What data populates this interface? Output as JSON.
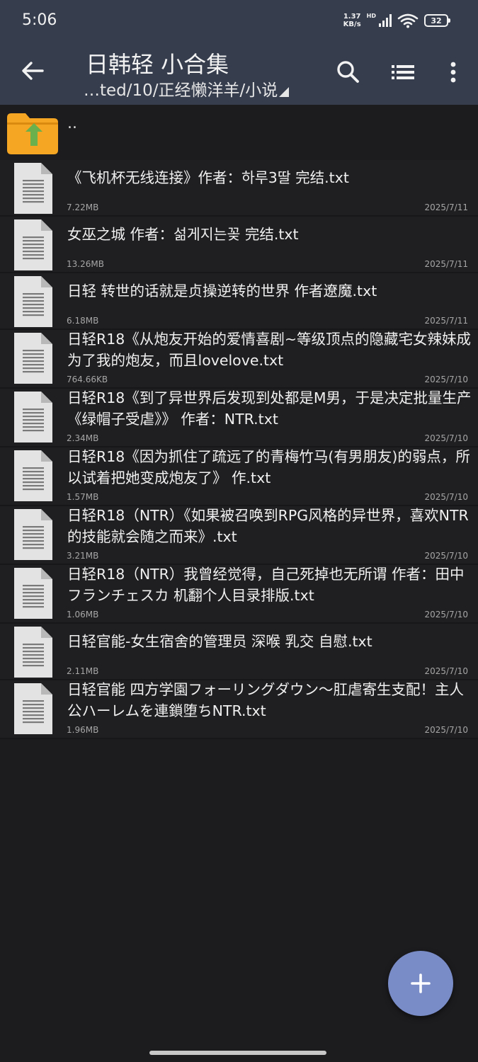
{
  "status_bar": {
    "time": "5:06",
    "net_speed_value": "1.37",
    "net_speed_unit": "KB/s",
    "signal_label": "HD",
    "battery_level": "32"
  },
  "toolbar": {
    "title": "日韩轻 小合集",
    "path": "…ted/10/正经懒洋羊/小说",
    "icons": [
      "back-arrow-icon",
      "search-icon",
      "list-view-icon",
      "more-vert-icon"
    ]
  },
  "parent_entry": {
    "label": ".."
  },
  "files": [
    {
      "name": "《飞机杯无线连接》作者：하루3딸 完结.txt",
      "size": "7.22MB",
      "date": "2025/7/11"
    },
    {
      "name": "女巫之城 作者：섦게지는꽂 完结.txt",
      "size": "13.26MB",
      "date": "2025/7/11"
    },
    {
      "name": "日轻 转世的话就是贞操逆转的世界 作者遼魔.txt",
      "size": "6.18MB",
      "date": "2025/7/11"
    },
    {
      "name": "日轻R18《从炮友开始的爱情喜剧~等级顶点的隐藏宅女辣妹成为了我的炮友，而且lovelove.txt",
      "size": "764.66KB",
      "date": "2025/7/10"
    },
    {
      "name": "日轻R18《到了异世界后发现到处都是M男，于是决定批量生产《绿帽子受虐》》 作者：NTR.txt",
      "size": "2.34MB",
      "date": "2025/7/10"
    },
    {
      "name": "日轻R18《因为抓住了疏远了的青梅竹马(有男朋友)的弱点，所以试着把她变成炮友了》 作.txt",
      "size": "1.57MB",
      "date": "2025/7/10"
    },
    {
      "name": "日轻R18（NTR）《如果被召唤到RPG风格的异世界，喜欢NTR的技能就会随之而来》.txt",
      "size": "3.21MB",
      "date": "2025/7/10"
    },
    {
      "name": "日轻R18（NTR）我曾经觉得，自己死掉也无所谓 作者：田中フランチェスカ 机翻个人目录排版.txt",
      "size": "1.06MB",
      "date": "2025/7/10"
    },
    {
      "name": "日轻官能-女生宿舍的管理员 深喉 乳交 自慰.txt",
      "size": "2.11MB",
      "date": "2025/7/10"
    },
    {
      "name": "日轻官能 四方学園フォーリングダウン～肛虐寄生支配！主人公ハーレムを連鎖堕ちNTR.txt",
      "size": "1.96MB",
      "date": "2025/7/10"
    }
  ],
  "fab": {
    "icon": "plus-icon"
  },
  "colors": {
    "toolbar_bg": "#363d4d",
    "page_bg": "#1c1c1f",
    "folder_orange": "#f5a623",
    "folder_arrow_green": "#6ab04c",
    "fab_bg": "#7a8cc8"
  }
}
